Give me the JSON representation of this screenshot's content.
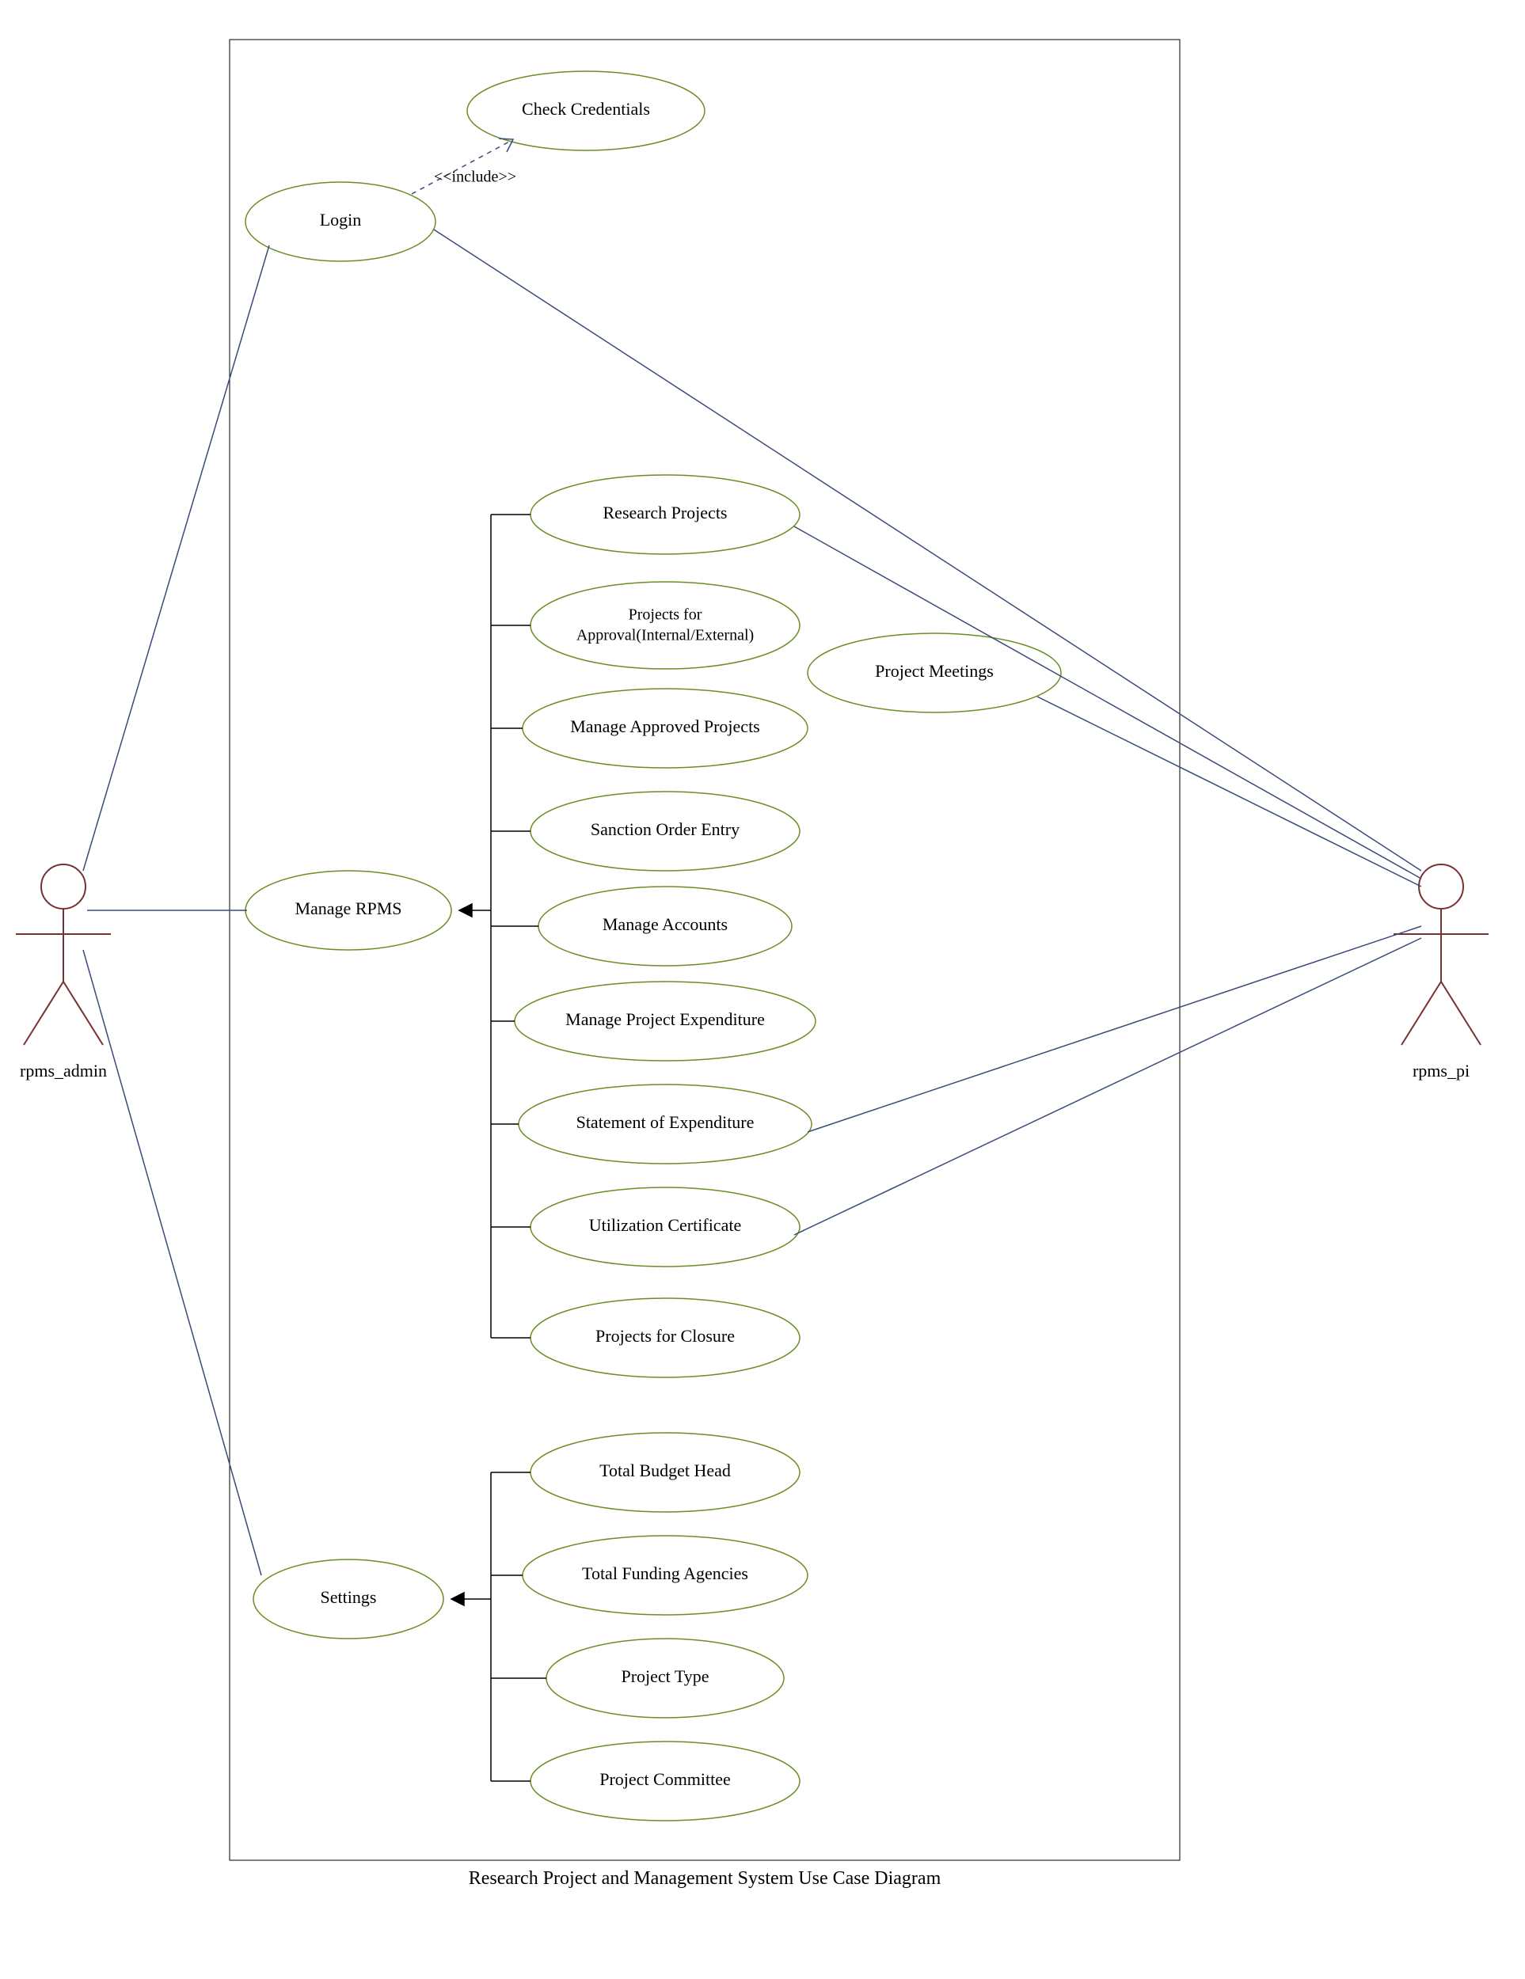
{
  "diagram": {
    "caption": "Research Project and Management System Use Case Diagram",
    "actors": {
      "admin": "rpms_admin",
      "pi": "rpms_pi"
    },
    "usecases": {
      "login": "Login",
      "check_credentials": "Check Credentials",
      "manage_rpms": "Manage RPMS",
      "settings": "Settings",
      "research_projects": "Research Projects",
      "projects_for_approval_l1": "Projects for",
      "projects_for_approval_l2": "Approval(Internal/External)",
      "manage_approved_projects": "Manage Approved Projects",
      "sanction_order_entry": "Sanction Order Entry",
      "manage_accounts": "Manage Accounts",
      "manage_project_expenditure": "Manage Project Expenditure",
      "statement_of_expenditure": "Statement of Expenditure",
      "utilization_certificate": "Utilization Certificate",
      "projects_for_closure": "Projects for Closure",
      "project_meetings": "Project Meetings",
      "total_budget_head": "Total Budget Head",
      "total_funding_agencies": "Total Funding Agencies",
      "project_type": "Project Type",
      "project_committee": "Project Committee"
    },
    "relations": {
      "include": "<<include>>"
    }
  }
}
